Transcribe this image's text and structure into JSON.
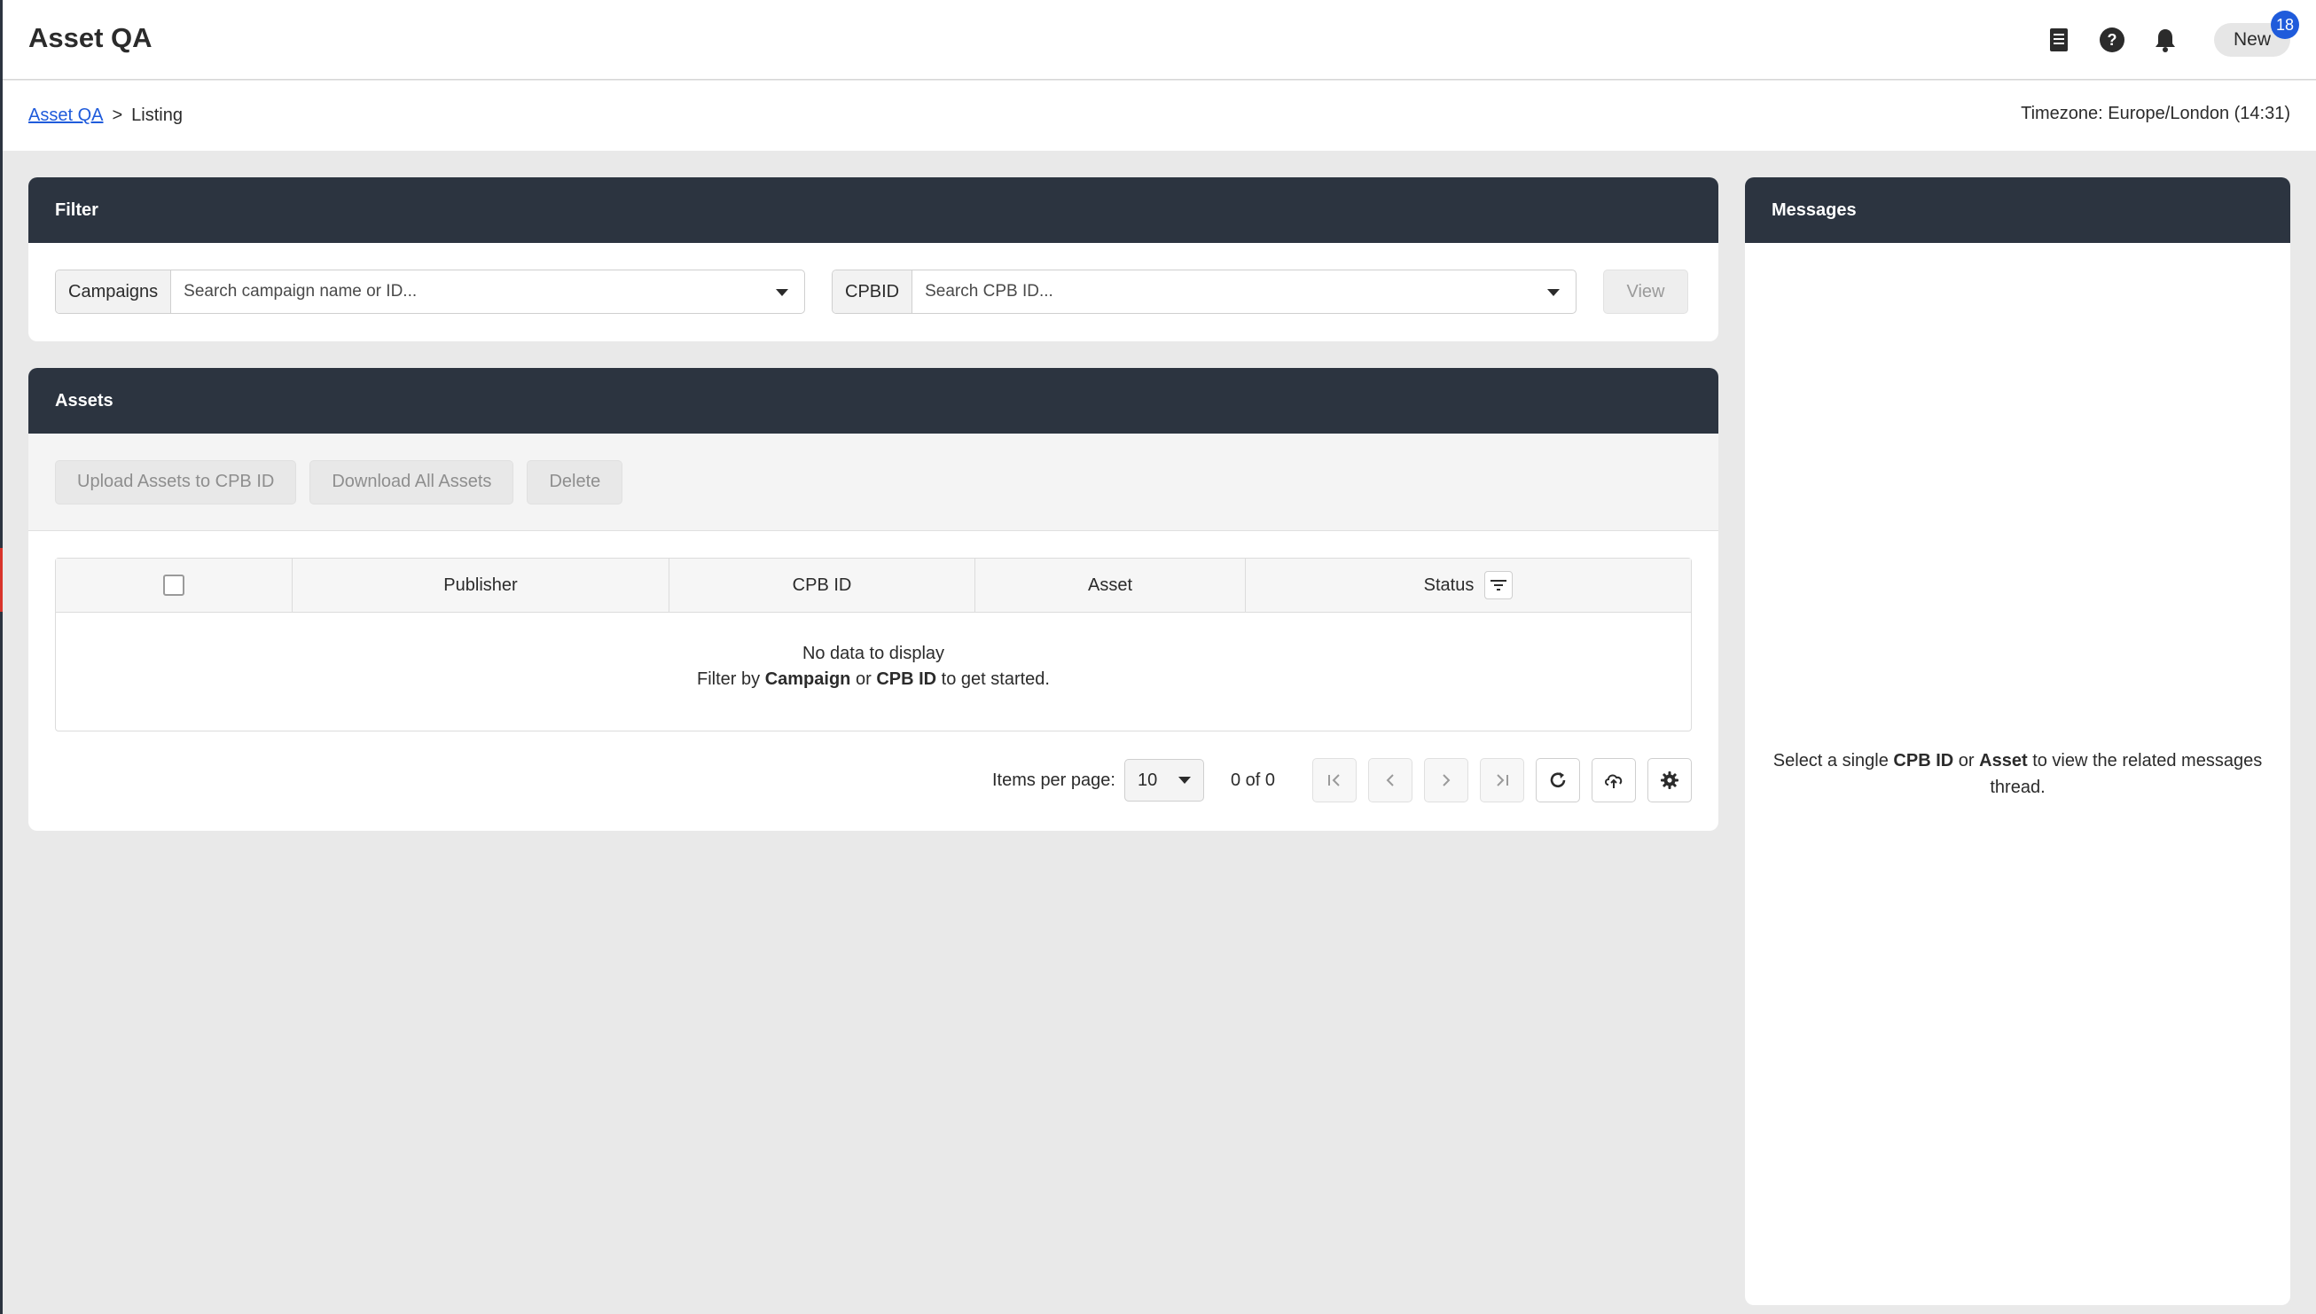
{
  "app": {
    "title": "Asset QA"
  },
  "header": {
    "new_label": "New",
    "notification_count": "18",
    "icons": [
      "document-icon",
      "help-icon",
      "bell-icon"
    ]
  },
  "breadcrumb": {
    "root": "Asset QA",
    "separator": ">",
    "current": "Listing"
  },
  "timezone": "Timezone: Europe/London (14:31)",
  "filter": {
    "title": "Filter",
    "campaigns_label": "Campaigns",
    "campaigns_placeholder": "Search campaign name or ID...",
    "cpbid_label": "CPBID",
    "cpbid_placeholder": "Search CPB ID...",
    "view_label": "View"
  },
  "assets": {
    "title": "Assets",
    "upload_label": "Upload Assets to CPB ID",
    "download_label": "Download All Assets",
    "delete_label": "Delete",
    "columns": [
      "Publisher",
      "CPB ID",
      "Asset",
      "Status"
    ],
    "empty": {
      "line1": "No data to display",
      "filter_by": "Filter by",
      "campaign": "Campaign",
      "or": "or",
      "cpb_id": "CPB ID",
      "to_start": "to get started."
    },
    "pager": {
      "items_per_page_label": "Items per page:",
      "items_per_page": "10",
      "range": "0 of 0"
    }
  },
  "messages": {
    "title": "Messages",
    "hint_pre": "Select a single",
    "hint_cpb": "CPB ID",
    "hint_or": "or",
    "hint_asset": "Asset",
    "hint_post": "to view the related messages thread."
  },
  "colors": {
    "header_dark": "#2c3440",
    "link": "#1f5bdb",
    "badge": "#1f5bdb",
    "page_bg": "#e9e9e9"
  }
}
